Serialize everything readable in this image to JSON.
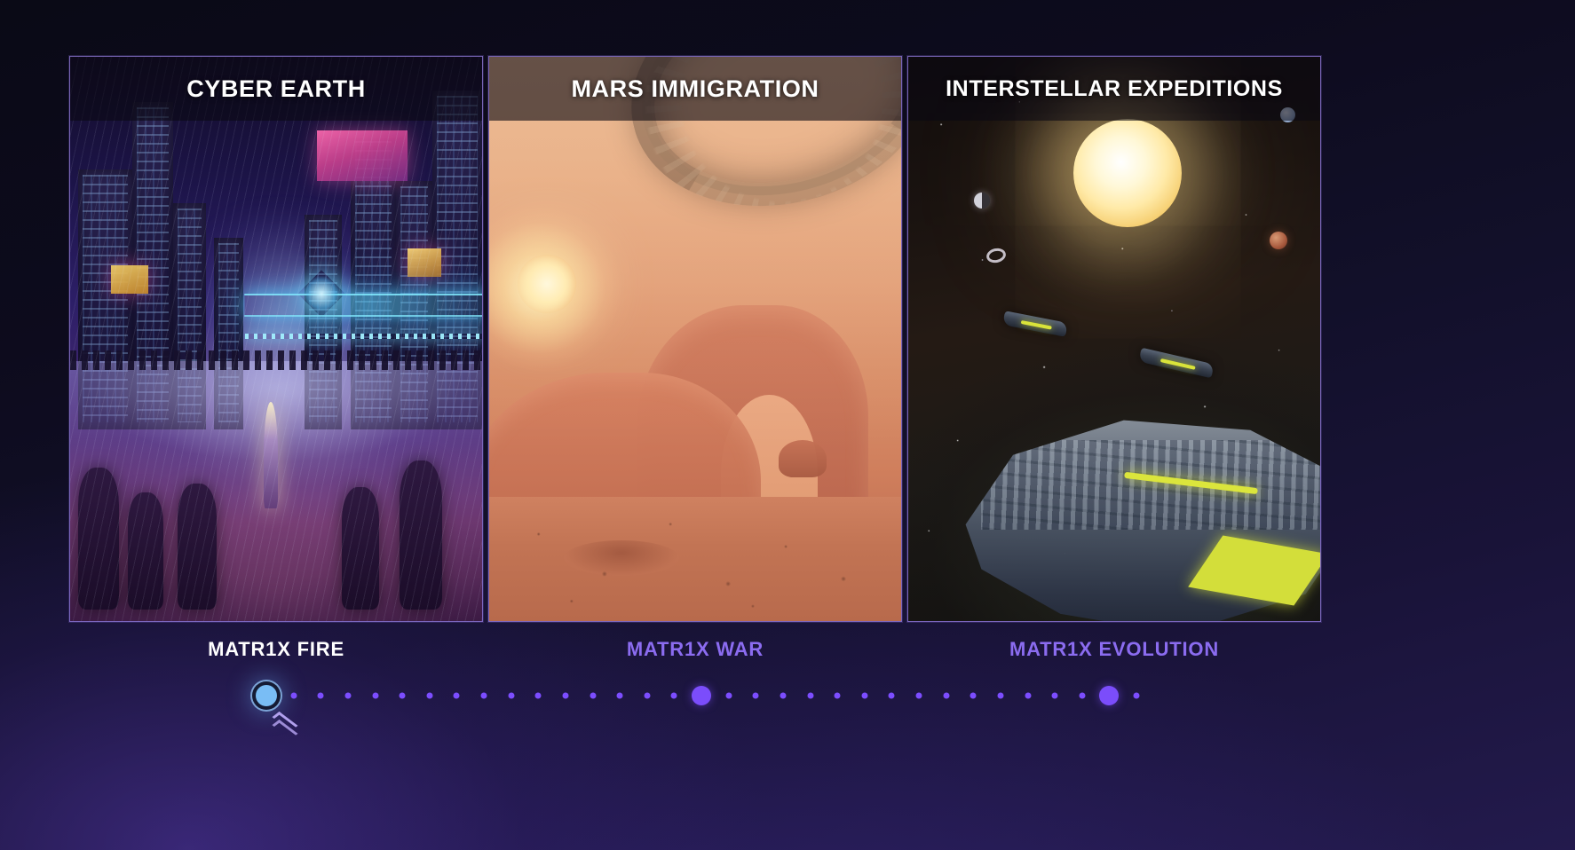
{
  "panels": [
    {
      "id": "cyber-earth",
      "title": "CYBER EARTH",
      "label": "MATR1X FIRE",
      "state": "active",
      "art": "cyberpunk-city-neon-street-crowd"
    },
    {
      "id": "mars-immigration",
      "title": "MARS IMMIGRATION",
      "label": "MATR1X WAR",
      "state": "inactive",
      "art": "mars-desert-arch-orbital-ring-station"
    },
    {
      "id": "interstellar-expeditions",
      "title": "INTERSTELLAR EXPEDITIONS",
      "label": "MATR1X EVOLUTION",
      "state": "inactive",
      "art": "deep-space-star-planets-capital-ship"
    }
  ],
  "timeline": {
    "markers": [
      {
        "position": 0,
        "kind": "active"
      },
      {
        "position": 49,
        "kind": "milestone"
      },
      {
        "position": 97,
        "kind": "milestone"
      }
    ],
    "total_dots": 33,
    "scroll_hint_icon": "double-chevron-up-icon"
  },
  "colors": {
    "active_label": "#ffffff",
    "inactive_label": "#8b6cf0",
    "active_marker": "#79bdf5",
    "milestone_marker": "#7b4dfb",
    "track_dot": "#7c4dff",
    "panel_border": "#a78bfa",
    "chevron": "#b9a7f5"
  }
}
